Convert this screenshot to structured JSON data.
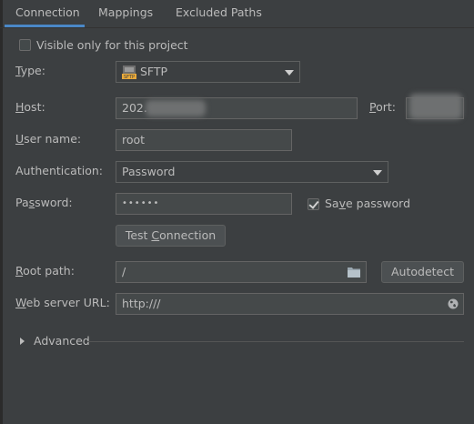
{
  "tabs": [
    {
      "label": "Connection",
      "active": true
    },
    {
      "label": "Mappings",
      "active": false
    },
    {
      "label": "Excluded Paths",
      "active": false
    }
  ],
  "visible_only": {
    "label": "Visible only for this project",
    "checked": false
  },
  "type": {
    "label": "Type:",
    "value": "SFTP",
    "icon": "sftp-icon"
  },
  "host": {
    "label": "Host:",
    "value": "202."
  },
  "port": {
    "label": "Port:"
  },
  "user_name": {
    "label": "User name:",
    "value": "root"
  },
  "authentication": {
    "label": "Authentication:",
    "value": "Password"
  },
  "password": {
    "label": "Password:",
    "value": "••••••"
  },
  "save_password": {
    "label": "Save password",
    "checked": true
  },
  "test_connection": {
    "label": "Test Connection"
  },
  "root_path": {
    "label": "Root path:",
    "value": "/"
  },
  "autodetect": {
    "label": "Autodetect"
  },
  "web_server_url": {
    "label": "Web server URL:",
    "value": "http:///"
  },
  "advanced": {
    "label": "Advanced"
  },
  "colors": {
    "accent": "#4a88c7",
    "background": "#3c3f41",
    "field": "#45494a",
    "text": "#bbbbbb",
    "sftp_icon": "#e8a93a"
  }
}
